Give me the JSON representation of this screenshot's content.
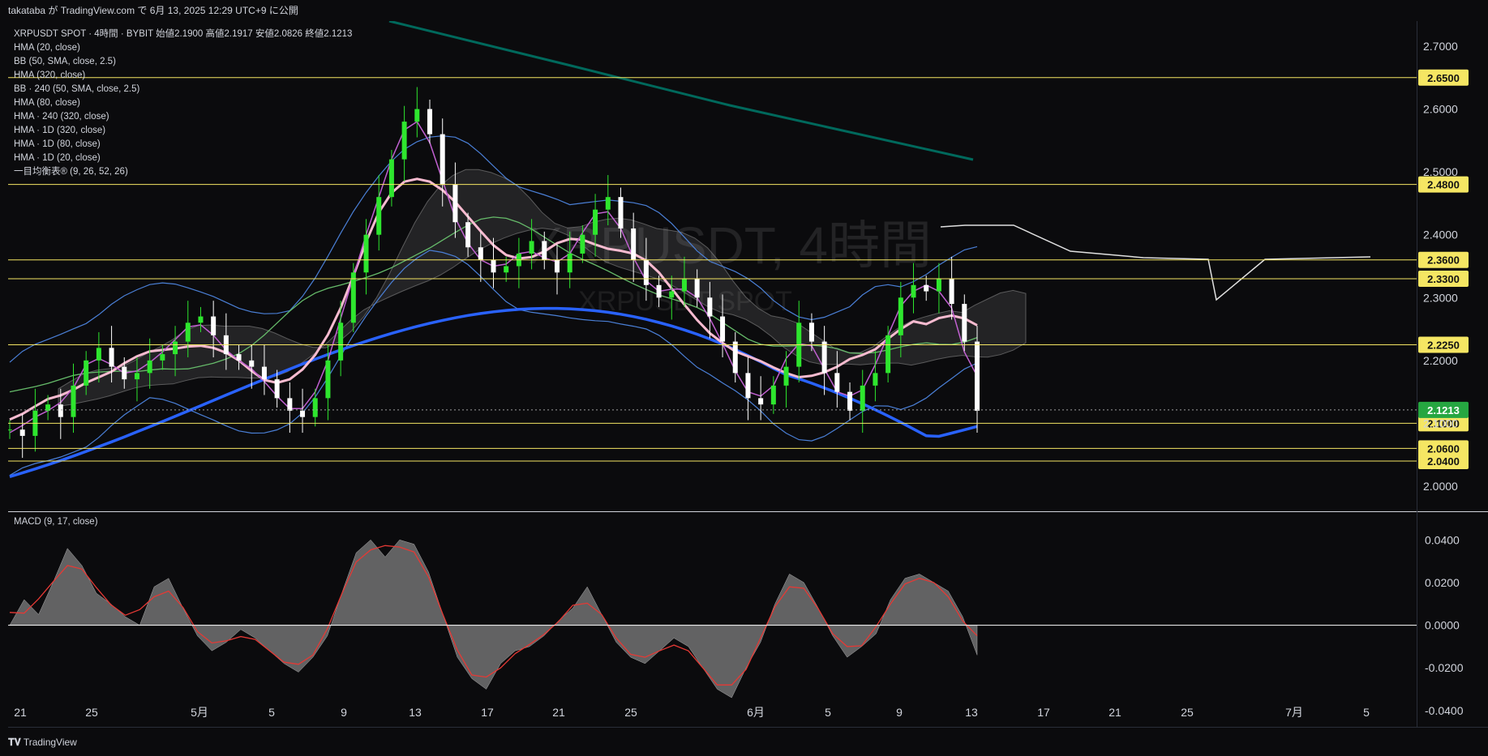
{
  "header": {
    "publish_text": "takataba が TradingView.com で 6月 13, 2025 12:29 UTC+9 に公開"
  },
  "legend": {
    "symbol_line": "XRPUSDT SPOT · 4時間 · BYBIT",
    "ohlc": [
      {
        "label": "始値",
        "value": "2.1900"
      },
      {
        "label": "高値",
        "value": "2.1917"
      },
      {
        "label": "安値",
        "value": "2.0826"
      },
      {
        "label": "終値",
        "value": "2.1213"
      }
    ],
    "indicators": [
      "HMA (20, close)",
      "BB (50, SMA, close, 2.5)",
      "HMA (320, close)",
      "BB · 240 (50, SMA, close, 2.5)",
      "HMA (80, close)",
      "HMA · 240 (320, close)",
      "HMA · 1D (320, close)",
      "HMA · 1D (80, close)",
      "HMA · 1D (20, close)",
      "一目均衡表® (9, 26, 52, 26)"
    ],
    "macd_label": "MACD (9, 17, close)"
  },
  "watermark": {
    "main": "XRPUSDT, 4時間",
    "sub": "XRPUSDT SPOT"
  },
  "footer": {
    "brand": "TradingView"
  },
  "colors": {
    "background": "#0b0b0d",
    "level_line": "#f5e663",
    "level_badge": "#f5e663",
    "last_price_badge": "#26a641",
    "candle_up": "#2ee62e",
    "candle_down": "#ffffff",
    "hma_320": "#2962ff",
    "hma_80": "#f8bbd0",
    "hma_20": "#c060d0",
    "bb": "#4a7fd6",
    "daily_hma": "#00695c",
    "macd_hist": "#808080",
    "macd_signal": "#e53935"
  },
  "chart_data": [
    {
      "type": "candlestick",
      "ylim": [
        1.96,
        2.74
      ],
      "y_ticks": [
        "2.7000",
        "2.6000",
        "2.5000",
        "2.4000",
        "2.3000",
        "2.2000",
        "2.1000",
        "2.0000"
      ],
      "x_ticks": [
        "21",
        "25",
        "5月",
        "5",
        "9",
        "13",
        "17",
        "21",
        "25",
        "6月",
        "5",
        "9",
        "13",
        "17",
        "21",
        "25",
        "7月",
        "5"
      ],
      "horizontal_levels": [
        {
          "value": 2.65,
          "label": "2.6500"
        },
        {
          "value": 2.48,
          "label": "2.4800"
        },
        {
          "value": 2.36,
          "label": "2.3600"
        },
        {
          "value": 2.33,
          "label": "2.3300"
        },
        {
          "value": 2.225,
          "label": "2.2250"
        },
        {
          "value": 2.1,
          "label": "2.1000"
        },
        {
          "value": 2.06,
          "label": "2.0600"
        },
        {
          "value": 2.04,
          "label": "2.0400"
        }
      ],
      "last_price": {
        "value": 2.1213,
        "label": "2.1213"
      },
      "close_series_approx": [
        2.09,
        2.08,
        2.12,
        2.13,
        2.11,
        2.16,
        2.2,
        2.22,
        2.19,
        2.17,
        2.18,
        2.2,
        2.21,
        2.23,
        2.26,
        2.27,
        2.24,
        2.21,
        2.2,
        2.19,
        2.17,
        2.14,
        2.12,
        2.11,
        2.14,
        2.2,
        2.26,
        2.34,
        2.4,
        2.46,
        2.52,
        2.58,
        2.6,
        2.56,
        2.48,
        2.42,
        2.38,
        2.36,
        2.34,
        2.35,
        2.37,
        2.39,
        2.36,
        2.34,
        2.37,
        2.4,
        2.44,
        2.46,
        2.41,
        2.36,
        2.32,
        2.3,
        2.31,
        2.33,
        2.3,
        2.27,
        2.23,
        2.18,
        2.14,
        2.13,
        2.16,
        2.19,
        2.26,
        2.23,
        2.18,
        2.15,
        2.12,
        2.16,
        2.18,
        2.24,
        2.3,
        2.32,
        2.31,
        2.33,
        2.29,
        2.23,
        2.12
      ]
    },
    {
      "type": "histogram",
      "title": "MACD (9, 17, close)",
      "ylim": [
        -0.045,
        0.05
      ],
      "y_ticks": [
        "0.0400",
        "0.0200",
        "0.0000",
        "-0.0200",
        "-0.0400"
      ],
      "values_approx": [
        0.0,
        0.012,
        0.005,
        0.02,
        0.036,
        0.028,
        0.015,
        0.01,
        0.004,
        0.0,
        0.018,
        0.022,
        0.008,
        -0.005,
        -0.012,
        -0.008,
        -0.002,
        -0.006,
        -0.012,
        -0.018,
        -0.022,
        -0.015,
        -0.005,
        0.015,
        0.034,
        0.04,
        0.032,
        0.04,
        0.038,
        0.025,
        0.005,
        -0.015,
        -0.025,
        -0.03,
        -0.018,
        -0.012,
        -0.01,
        -0.005,
        0.002,
        0.008,
        0.018,
        0.005,
        -0.008,
        -0.015,
        -0.018,
        -0.012,
        -0.006,
        -0.01,
        -0.02,
        -0.03,
        -0.034,
        -0.02,
        -0.008,
        0.01,
        0.024,
        0.02,
        0.008,
        -0.005,
        -0.015,
        -0.01,
        -0.004,
        0.012,
        0.022,
        0.024,
        0.02,
        0.016,
        0.004,
        -0.014
      ]
    }
  ]
}
